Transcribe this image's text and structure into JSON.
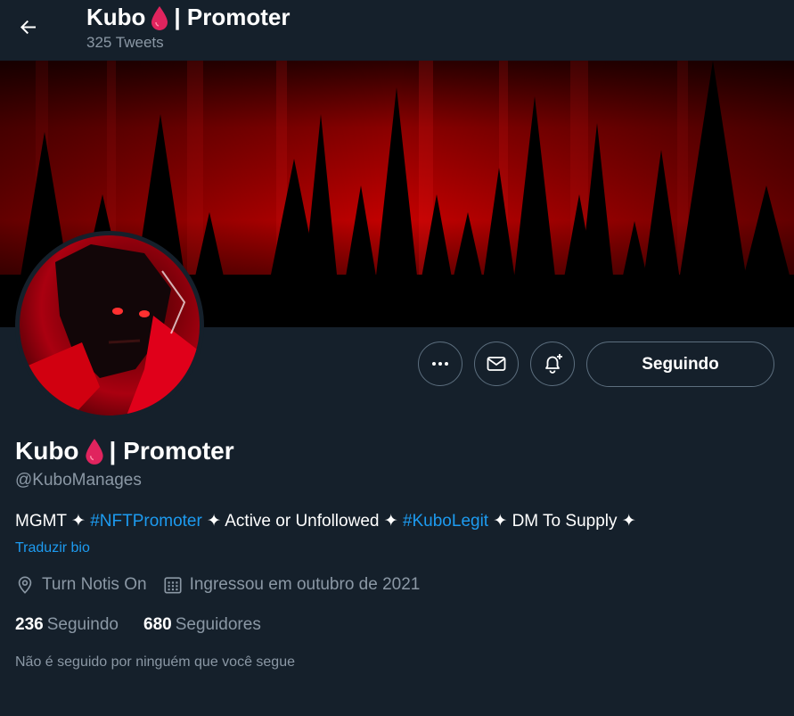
{
  "header": {
    "name_text": "Kubo",
    "name_suffix": "| Promoter",
    "tweet_count": "325 Tweets"
  },
  "actions": {
    "follow_label": "Seguindo"
  },
  "profile": {
    "name_text": "Kubo",
    "name_suffix": "| Promoter",
    "handle": "@KuboManages",
    "bio": {
      "part1": "MGMT ✦ ",
      "hashtag1": "#NFTPromoter",
      "part2": " ✦ Active or Unfollowed ✦ ",
      "hashtag2": "#KuboLegit",
      "part3": " ✦ DM To Supply ✦"
    },
    "translate_bio": "Traduzir bio",
    "location": "Turn Notis On",
    "joined": "Ingressou em outubro de 2021",
    "following_count": "236",
    "following_label": "Seguindo",
    "followers_count": "680",
    "followers_label": "Seguidores",
    "followed_by": "Não é seguido por ninguém que você segue"
  },
  "colors": {
    "background": "#15202b",
    "accent": "#1d9bf0",
    "muted": "#8b98a5",
    "drop": "#e0245e"
  },
  "icons": [
    "back-arrow-icon",
    "blood-drop-icon",
    "more-icon",
    "mail-icon",
    "notification-bell-plus-icon",
    "location-pin-icon",
    "calendar-icon"
  ]
}
